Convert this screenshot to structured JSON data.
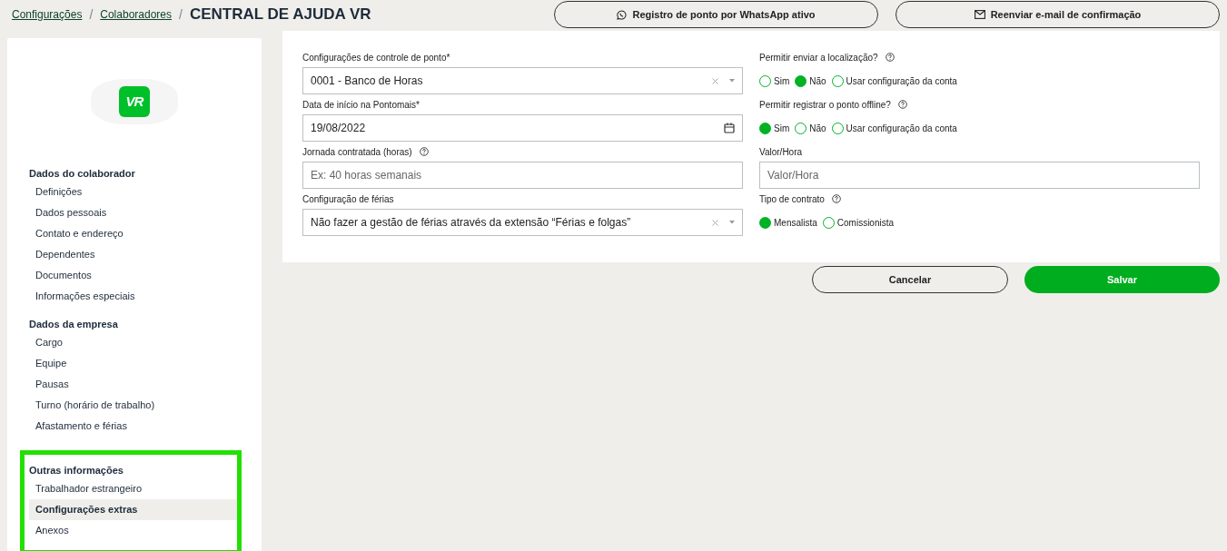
{
  "breadcrumb": [
    {
      "label": "Configurações",
      "separator": "/"
    },
    {
      "label": "Colaboradores",
      "separator": "/"
    }
  ],
  "title": "CENTRAL DE AJUDA VR",
  "header_buttons": [
    {
      "label": "Registro de ponto por WhatsApp ativo"
    },
    {
      "label": "Reenviar e-mail de confirmação"
    }
  ],
  "sidebar": {
    "logo_text": "VR",
    "sections": [
      {
        "title": "Dados do colaborador",
        "highlighted": false,
        "items": [
          {
            "label": "Definições",
            "selected": false
          },
          {
            "label": "Dados pessoais",
            "selected": false
          },
          {
            "label": "Contato e endereço",
            "selected": false
          },
          {
            "label": "Dependentes",
            "selected": false
          },
          {
            "label": "Documentos",
            "selected": false
          },
          {
            "label": "Informações especiais",
            "selected": false
          }
        ]
      },
      {
        "title": "Dados da empresa",
        "highlighted": false,
        "items": [
          {
            "label": "Cargo",
            "selected": false
          },
          {
            "label": "Equipe",
            "selected": false
          },
          {
            "label": "Pausas",
            "selected": false
          },
          {
            "label": "Turno (horário de trabalho)",
            "selected": false
          },
          {
            "label": "Afastamento e férias",
            "selected": false
          }
        ]
      },
      {
        "title": "Outras informações",
        "highlighted": true,
        "items": [
          {
            "label": "Trabalhador estrangeiro",
            "selected": false
          },
          {
            "label": "Configurações extras",
            "selected": true
          },
          {
            "label": "Anexos",
            "selected": false
          }
        ]
      }
    ]
  },
  "form": {
    "left": [
      {
        "kind": "select",
        "label": "Configurações de controle de ponto*",
        "help": false,
        "value": "0001 - Banco de Horas"
      },
      {
        "kind": "date",
        "label": "Data de início na Pontomais*",
        "help": false,
        "value": "19/08/2022"
      },
      {
        "kind": "text",
        "label": "Jornada contratada (horas)",
        "help": true,
        "placeholder": "Ex: 40 horas semanais"
      },
      {
        "kind": "select",
        "label": "Configuração de férias",
        "help": false,
        "value": "Não fazer a gestão de férias através da extensão “Férias e folgas”"
      }
    ],
    "right": [
      {
        "kind": "radio",
        "label": "Permitir enviar a localização?",
        "help": true,
        "options": [
          {
            "label": "Sim",
            "selected": false
          },
          {
            "label": "Não",
            "selected": true
          },
          {
            "label": "Usar configuração da conta",
            "selected": false
          }
        ]
      },
      {
        "kind": "radio",
        "label": "Permitir registrar o ponto offline?",
        "help": true,
        "options": [
          {
            "label": "Sim",
            "selected": true
          },
          {
            "label": "Não",
            "selected": false
          },
          {
            "label": "Usar configuração da conta",
            "selected": false
          }
        ]
      },
      {
        "kind": "text",
        "label": "Valor/Hora",
        "help": false,
        "placeholder": "Valor/Hora"
      },
      {
        "kind": "radio",
        "label": "Tipo de contrato",
        "help": true,
        "options": [
          {
            "label": "Mensalista",
            "selected": true
          },
          {
            "label": "Comissionista",
            "selected": false
          }
        ]
      }
    ]
  },
  "actions": [
    {
      "label": "Cancelar",
      "kind": "secondary"
    },
    {
      "label": "Salvar",
      "kind": "primary"
    }
  ]
}
